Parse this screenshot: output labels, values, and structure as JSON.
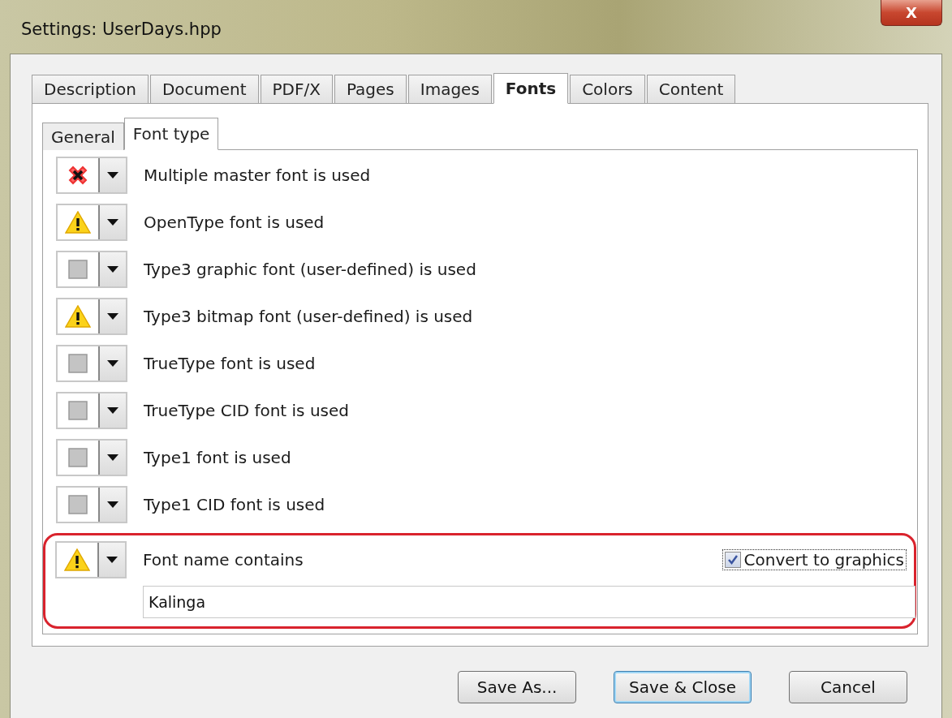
{
  "window": {
    "title": "Settings:  UserDays.hpp",
    "close_label": "X"
  },
  "tabs": [
    {
      "label": "Description",
      "selected": false
    },
    {
      "label": "Document",
      "selected": false
    },
    {
      "label": "PDF/X",
      "selected": false
    },
    {
      "label": "Pages",
      "selected": false
    },
    {
      "label": "Images",
      "selected": false
    },
    {
      "label": "Fonts",
      "selected": true
    },
    {
      "label": "Colors",
      "selected": false
    },
    {
      "label": "Content",
      "selected": false
    }
  ],
  "subtabs": [
    {
      "label": "General",
      "selected": false
    },
    {
      "label": "Font type",
      "selected": true
    }
  ],
  "rules": [
    {
      "label": "Multiple master font is used",
      "kind": "error"
    },
    {
      "label": "OpenType font is used",
      "kind": "warning"
    },
    {
      "label": "Type3 graphic font (user-defined) is used",
      "kind": "ignore"
    },
    {
      "label": "Type3 bitmap font (user-defined) is used",
      "kind": "warning"
    },
    {
      "label": "TrueType font is used",
      "kind": "ignore"
    },
    {
      "label": "TrueType CID font is used",
      "kind": "ignore"
    },
    {
      "label": "Type1 font is used",
      "kind": "ignore"
    },
    {
      "label": "Type1 CID font is used",
      "kind": "ignore"
    }
  ],
  "font_name_rule": {
    "label": "Font name contains",
    "kind": "warning",
    "highlighted": true,
    "convert": {
      "label": "Convert to graphics",
      "checked": true
    },
    "value": "Kalinga"
  },
  "buttons": [
    {
      "label": "Save As...",
      "default": false
    },
    {
      "label": "Save & Close",
      "default": true
    },
    {
      "label": "Cancel",
      "default": false
    }
  ]
}
